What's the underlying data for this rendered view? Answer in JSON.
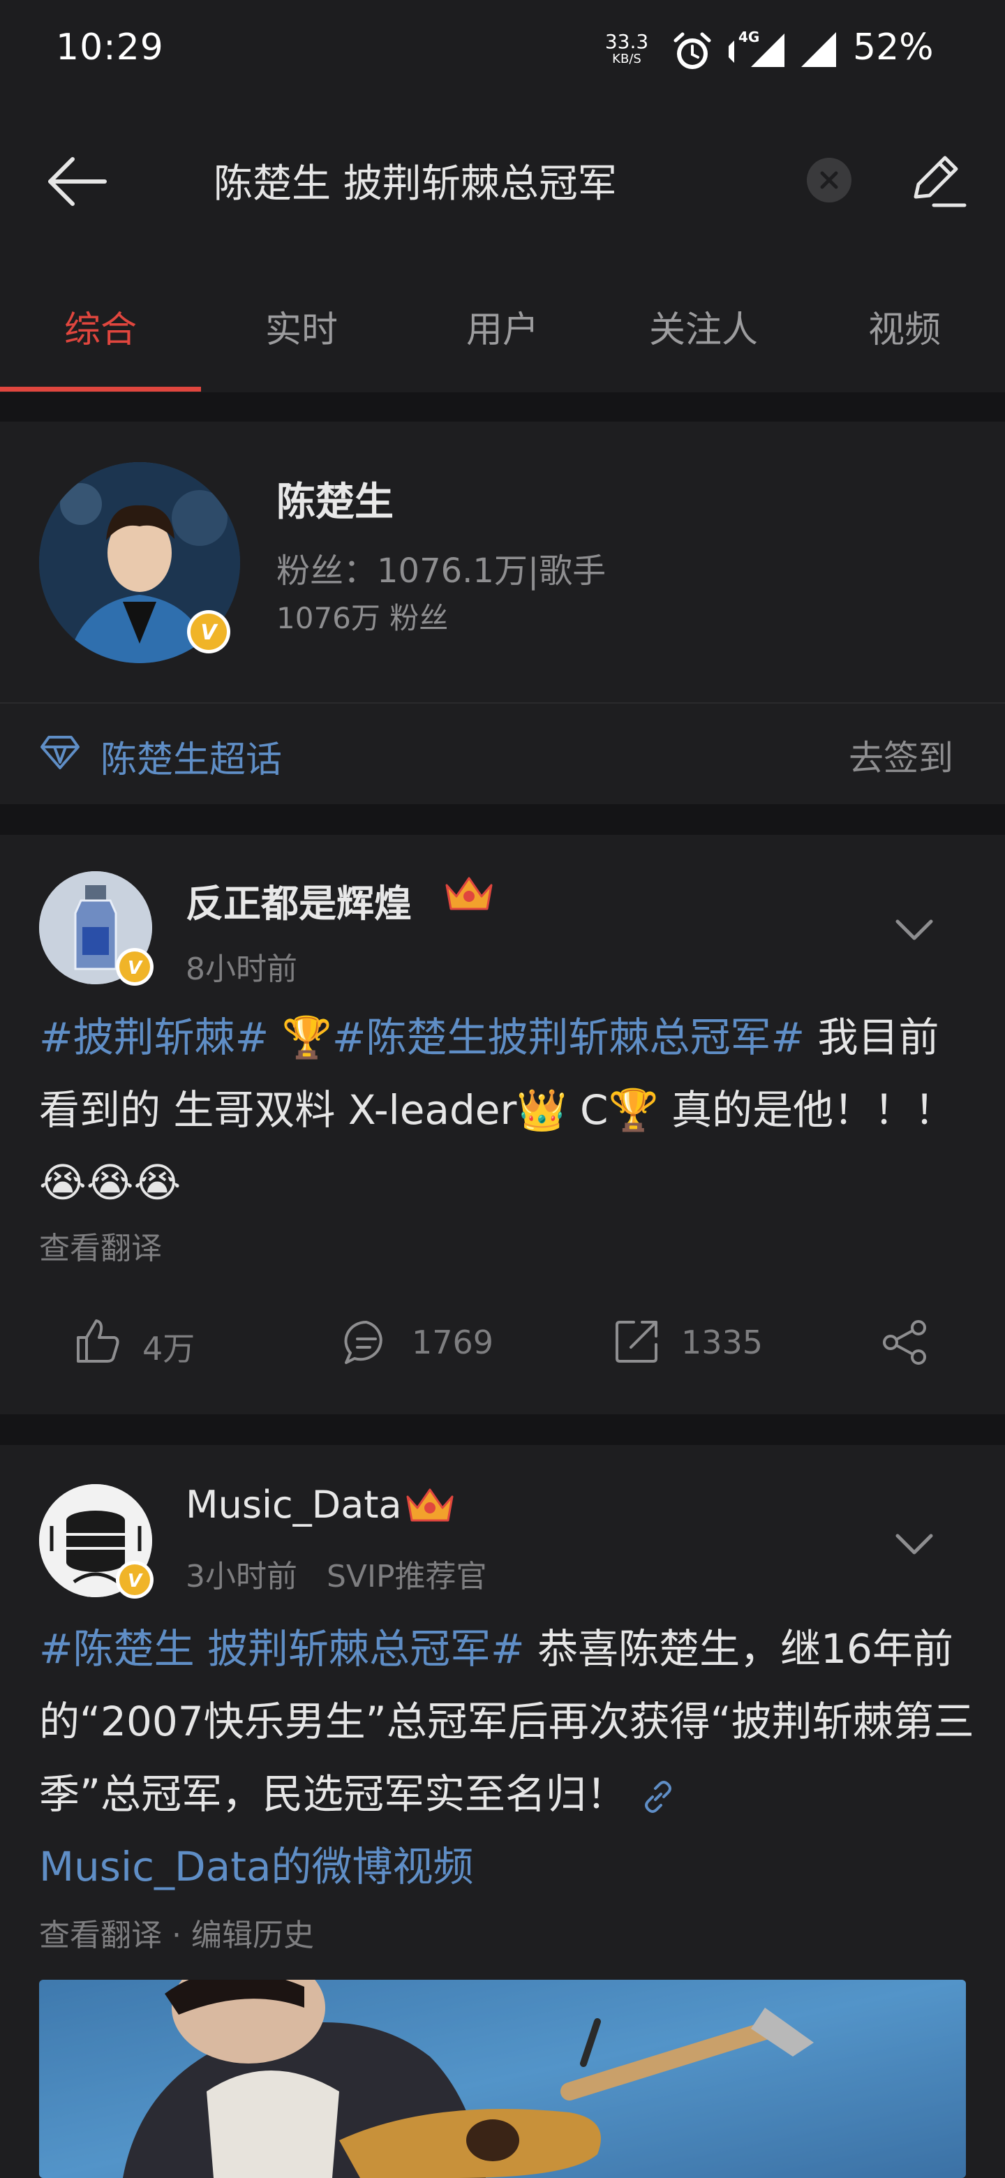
{
  "status_bar": {
    "time": "10:29",
    "net_speed_value": "33.3",
    "net_speed_unit": "KB/S",
    "network_type": "4G",
    "battery": "52%"
  },
  "search": {
    "query": "陈楚生 披荆斩棘总冠军"
  },
  "tabs": [
    {
      "label": "综合",
      "active": true
    },
    {
      "label": "实时",
      "active": false
    },
    {
      "label": "用户",
      "active": false
    },
    {
      "label": "关注人",
      "active": false
    },
    {
      "label": "视频",
      "active": false
    }
  ],
  "profile": {
    "name": "陈楚生",
    "fans_line": "粉丝：1076.1万|歌手",
    "fans_count": "1076万 粉丝",
    "verified_badge": "V",
    "supertopic_label": "陈楚生超话",
    "checkin_label": "去签到"
  },
  "posts": [
    {
      "author": "反正都是辉煌",
      "time": "8小时前",
      "badge": "V",
      "text": {
        "hashtag1": "#披荆斩棘#",
        "emoji1": "🏆",
        "hashtag2": "#陈楚生披荆斩棘总冠军#",
        "body1": " 我目前看到的 生哥双料 X-leader",
        "emoji2": "👑",
        "body2": " C",
        "emoji3": "🏆",
        "body3": " 真的是他！！！ ",
        "emoji4": "😭😭😭"
      },
      "sub_actions": "查看翻译",
      "likes": "4万",
      "comments": "1769",
      "reposts": "1335"
    },
    {
      "author": "Music_Data",
      "time": "3小时前",
      "role": "SVIP推荐官",
      "badge": "V",
      "text": {
        "hashtag1": "#陈楚生 披荆斩棘总冠军#",
        "body1": " 恭喜陈楚生，继16年前的“2007快乐男生”总冠军后再次获得“披荆斩棘第三季”总冠军，民选冠军实至名归！ ",
        "link": "Music_Data的微博视频"
      },
      "sub_actions": "查看翻译 · 编辑历史"
    }
  ],
  "colors": {
    "accent_red": "#e0463e",
    "link_blue": "#5f8ec6",
    "verified_gold": "#f0b428"
  }
}
